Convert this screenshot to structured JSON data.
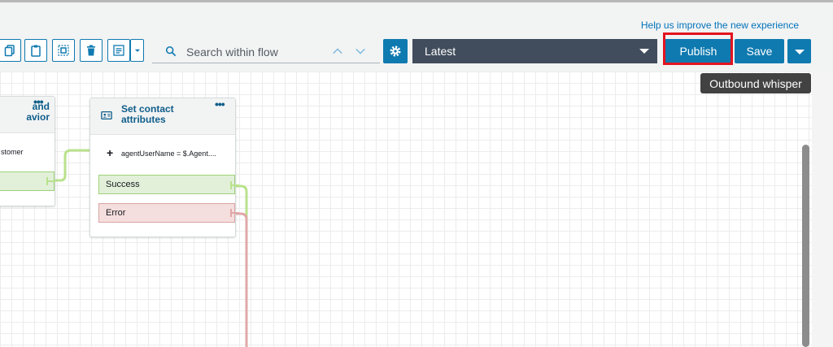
{
  "help_link": "Help us improve the new experience",
  "toolbar": {
    "search": {
      "placeholder": "Search within flow"
    },
    "version": {
      "selected": "Latest"
    },
    "publish_label": "Publish",
    "save_label": "Save"
  },
  "tooltip": "Outbound whisper",
  "canvas": {
    "left_block": {
      "title_line1": "and",
      "title_line2": "avior",
      "text": "stomer"
    },
    "set_contact_block": {
      "title_line1": "Set contact",
      "title_line2": "attributes",
      "attribute": "agentUserName = $.Agent....",
      "branches": [
        "Success",
        "Error"
      ]
    }
  },
  "colors": {
    "accent": "#0f7ab0",
    "select_bg": "#414d5c",
    "highlight": "#e3141e",
    "success_line": "#b9e28c",
    "error_line": "#e0a8a8"
  }
}
